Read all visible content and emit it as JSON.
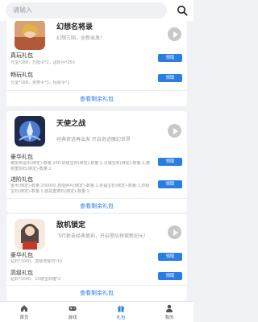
{
  "search": {
    "placeholder": "请输入"
  },
  "games": [
    {
      "name": "幻想名将录",
      "desc": "幻想三国，全新出发！",
      "more": "查看剩余礼包",
      "gifts": [
        {
          "title": "真玩礼包",
          "desc": "元宝*288，万能令*2，进阶丹*250",
          "button": "领取"
        },
        {
          "title": "畅玩礼包",
          "desc": "元宝*188，务势令*3，招贤令*1",
          "button": "领取"
        }
      ]
    },
    {
      "name": "天使之战",
      "desc": "经典奇迹再出发 开启奇迹魔幻世界",
      "more": "查看剩余礼包",
      "gifts": [
        {
          "title": "豪华礼包",
          "desc": "绑定命运币(绑定)-数量:200,初级宝石(绑定)-数量:1,灵魂宝石(绑定)-数量:1,拂晓重剑石(绑定)-数量:1",
          "button": "领取"
        },
        {
          "title": "进阶礼包",
          "desc": "金币(绑定)-数量:200000,技能碎片(绑定)-数量:2,祝福宝石(绑定)-数量:1,初级宝石(绑定)-数量:1,琥珀重铸石(绑定)-数量:1",
          "button": "领取"
        }
      ]
    },
    {
      "name": "敌机锁定",
      "desc": "飞行射击经典复刻，开启星际探索新纪元！",
      "more": "查看剩余礼包",
      "gifts": [
        {
          "title": "豪华礼包",
          "desc": "钻石*1000，高级洗炼石*10",
          "button": "领取"
        },
        {
          "title": "高级礼包",
          "desc": "钻石*1000，10级宝石箱*2",
          "button": "领取"
        }
      ]
    }
  ],
  "tabs": [
    {
      "label": "首页",
      "icon": "home-icon"
    },
    {
      "label": "游戏",
      "icon": "gamepad-icon"
    },
    {
      "label": "礼包",
      "icon": "gift-icon"
    },
    {
      "label": "我的",
      "icon": "user-icon"
    }
  ],
  "colors": {
    "accent": "#2a7de1",
    "background": "#f1f2f6"
  }
}
